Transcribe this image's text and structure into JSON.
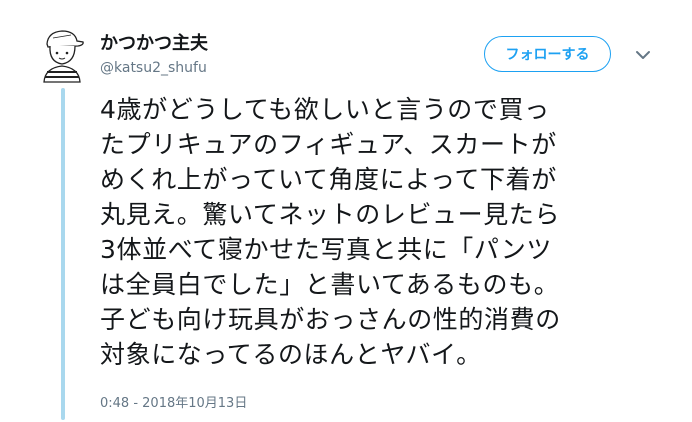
{
  "author": {
    "display_name": "かつかつ主夫",
    "handle": "@katsu2_shufu",
    "avatar_icon": "avatar-illustration-icon"
  },
  "follow_button": {
    "label": "フォローする"
  },
  "menu": {
    "caret_icon": "chevron-down-icon"
  },
  "tweet": {
    "lines": [
      "4歳がどうしても欲しいと言うので買っ",
      "たプリキュアのフィギュア、スカートが",
      "めくれ上がっていて角度によって下着が",
      "丸見え。驚いてネットのレビュー見たら",
      "3体並べて寝かせた写真と共に「パンツ",
      "は全員白でした」と書いてあるものも。",
      "子ども向け玩具がおっさんの性的消費の",
      "対象になってるのほんとヤバイ。"
    ],
    "timestamp": "0:48 - 2018年10月13日"
  },
  "colors": {
    "accent": "#1da1f2",
    "thread_line": "#a9d8ee",
    "secondary_text": "#657786",
    "primary_text": "#14171a"
  }
}
